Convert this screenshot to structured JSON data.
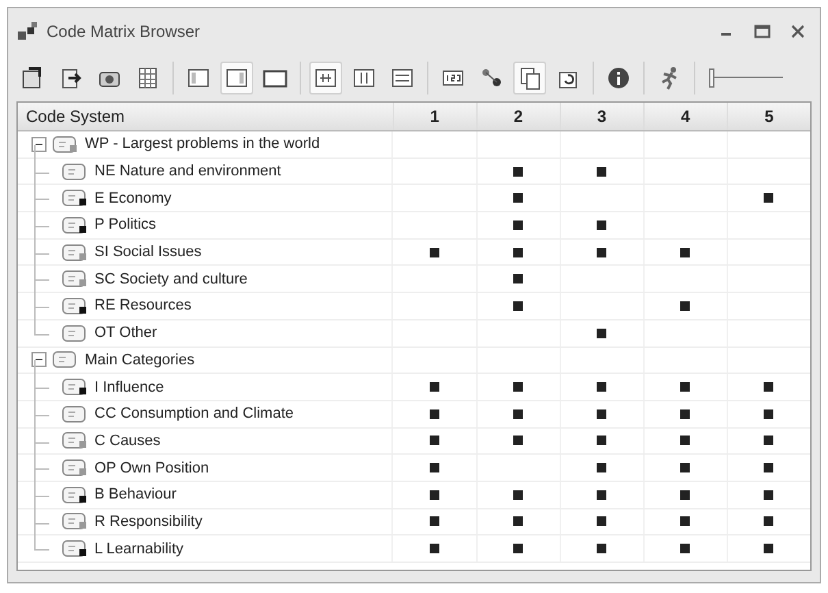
{
  "window": {
    "title": "Code Matrix Browser"
  },
  "toolbar": [
    {
      "kind": "export",
      "selected": false
    },
    {
      "kind": "import",
      "selected": false
    },
    {
      "kind": "camera",
      "selected": false
    },
    {
      "kind": "table",
      "selected": false
    },
    {
      "kind": "col-left",
      "selected": false
    },
    {
      "kind": "col-mid",
      "selected": true
    },
    {
      "kind": "panel",
      "selected": false
    },
    {
      "kind": "grid-a",
      "selected": true
    },
    {
      "kind": "grid-b",
      "selected": false
    },
    {
      "kind": "grid-c",
      "selected": false
    },
    {
      "kind": "numbers",
      "selected": false
    },
    {
      "kind": "nodes",
      "selected": false
    },
    {
      "kind": "copy",
      "selected": true
    },
    {
      "kind": "refresh",
      "selected": false
    },
    {
      "kind": "info",
      "selected": false
    },
    {
      "kind": "runner",
      "selected": false
    }
  ],
  "zoom_slider": {
    "level": 0.04
  },
  "table": {
    "columns": [
      "Code System",
      "1",
      "2",
      "3",
      "4",
      "5"
    ],
    "rows": [
      {
        "label": "WP - Largest problems in the world",
        "kind": "partly-coded",
        "expanded": true,
        "cells": [
          false,
          false,
          false,
          false,
          false
        ],
        "children": [
          {
            "label": "NE Nature and environment",
            "kind": "plain",
            "cells": [
              false,
              true,
              true,
              false,
              false
            ]
          },
          {
            "label": "E Economy",
            "kind": "coded",
            "cells": [
              false,
              true,
              false,
              false,
              true
            ]
          },
          {
            "label": "P Politics",
            "kind": "coded",
            "cells": [
              false,
              true,
              true,
              false,
              false
            ]
          },
          {
            "label": "SI Social Issues",
            "kind": "partly-coded",
            "cells": [
              true,
              true,
              true,
              true,
              false
            ]
          },
          {
            "label": "SC Society and culture",
            "kind": "partly-coded",
            "cells": [
              false,
              true,
              false,
              false,
              false
            ]
          },
          {
            "label": "RE Resources",
            "kind": "coded",
            "cells": [
              false,
              true,
              false,
              true,
              false
            ]
          },
          {
            "label": "OT Other",
            "kind": "plain",
            "cells": [
              false,
              false,
              true,
              false,
              false
            ]
          }
        ]
      },
      {
        "label": "Main Categories",
        "kind": "plain",
        "expanded": true,
        "cells": [
          false,
          false,
          false,
          false,
          false
        ],
        "children": [
          {
            "label": "I Influence",
            "kind": "coded",
            "cells": [
              true,
              true,
              true,
              true,
              true
            ]
          },
          {
            "label": "CC Consumption and Climate",
            "kind": "plain",
            "cells": [
              true,
              true,
              true,
              true,
              true
            ]
          },
          {
            "label": "C Causes",
            "kind": "partly-coded",
            "cells": [
              true,
              true,
              true,
              true,
              true
            ]
          },
          {
            "label": "OP Own Position",
            "kind": "partly-coded",
            "cells": [
              true,
              false,
              true,
              true,
              true
            ]
          },
          {
            "label": "B Behaviour",
            "kind": "coded",
            "cells": [
              true,
              true,
              true,
              true,
              true
            ]
          },
          {
            "label": "R Responsibility",
            "kind": "partly-coded",
            "cells": [
              true,
              true,
              true,
              true,
              true
            ]
          },
          {
            "label": "L Learnability",
            "kind": "coded",
            "cells": [
              true,
              true,
              true,
              true,
              true
            ]
          }
        ]
      }
    ]
  }
}
